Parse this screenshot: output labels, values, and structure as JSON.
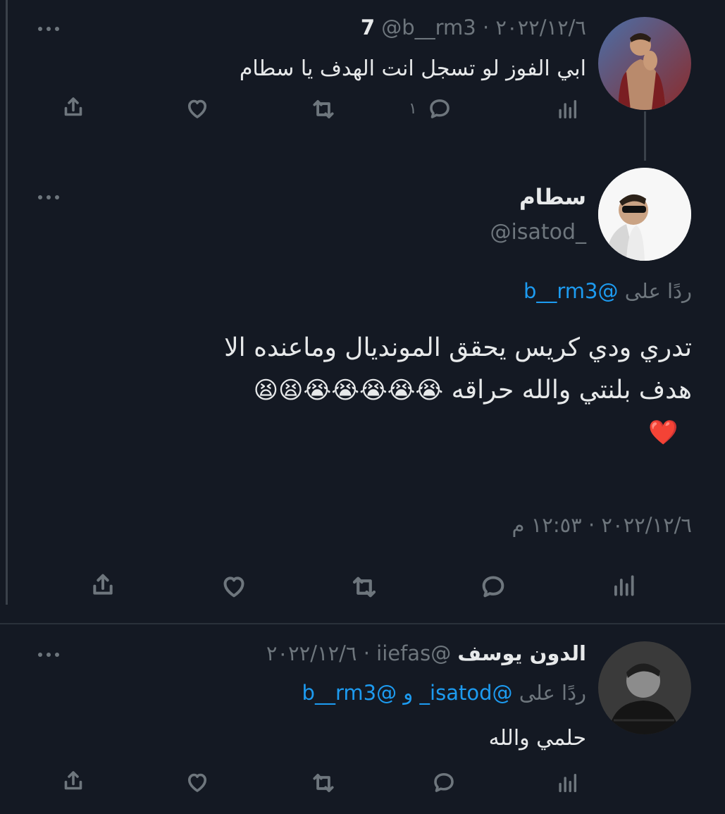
{
  "tweet1": {
    "name": "7",
    "handle_date": "@b__rm3 · ٢٠٢٢/١٢/٦",
    "text": "ابي الفوز لو تسجل انت الهدف يا سطام",
    "reply_count": "١"
  },
  "tweet2": {
    "name": "سطام",
    "handle": "@isatod_",
    "replying_prefix": "ردًا على",
    "replying_to": "@b__rm3",
    "text_line1": "تدري ودي كريس يحقق المونديال وماعنده الا",
    "text_line2": "هدف بلنتي والله حراقه",
    "emoji_row": "😭😭😭😭😭😫😫",
    "heart": "❤️",
    "timestamp": "٢٠٢٢/١٢/٦ · ١٢:٥٣ م"
  },
  "tweet3": {
    "name": "الدون يوسف",
    "handle_date": "@iiefas · ٢٠٢٢/١٢/٦",
    "replying_prefix": "ردًا على",
    "replying_to_1": "@isatod_",
    "replying_and": "و",
    "replying_to_2": "@b__rm3",
    "text": "حلمي والله"
  },
  "colors": {
    "background": "#141923",
    "link": "#1d9bf0",
    "muted": "#6e767d",
    "text": "#e7e9ea"
  },
  "icons": [
    "share-icon",
    "like-icon",
    "retweet-icon",
    "reply-icon",
    "analytics-icon",
    "more-icon"
  ]
}
